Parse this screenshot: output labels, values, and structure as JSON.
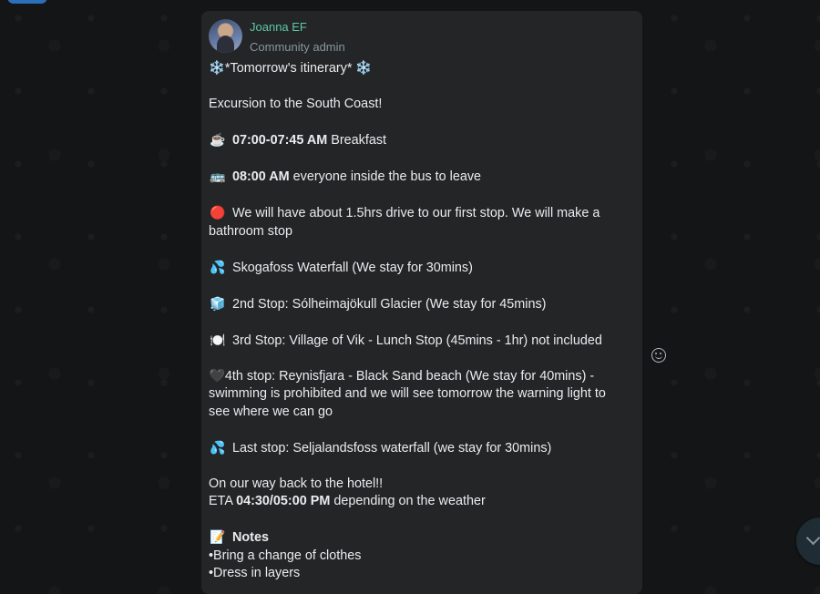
{
  "message": {
    "sender": "Joanna EF",
    "role": "Community admin",
    "title": "*Tomorrow's itinerary*",
    "intro": "Excursion to the South Coast!",
    "breakfast_time": "07:00-07:45 AM",
    "breakfast_text": "Breakfast",
    "bus_time": "08:00 AM",
    "bus_text": "everyone inside the bus to leave",
    "drive_text": "We will have about 1.5hrs drive to our first stop. We will make a",
    "drive_text_2": "bathroom stop",
    "stop1": "Skogafoss Waterfall (We stay for 30mins)",
    "stop2": "2nd Stop: Sólheimajökull Glacier (We stay for 45mins)",
    "stop3": "3rd Stop: Village of Vik - Lunch Stop (45mins - 1hr) not included",
    "stop4_line1": "4th stop: Reynisfjara - Black Sand beach (We stay for 40mins) -",
    "stop4_line2": "swimming is prohibited and we will see tomorrow the warning light to",
    "stop4_line3": "see where we can go",
    "last_stop": "Last stop: Seljalandsfoss waterfall (we stay for 30mins)",
    "return_text": "On our way back to the hotel!!",
    "eta_label": "ETA",
    "eta_time": "04:30/05:00 PM",
    "eta_text": "depending on the weather",
    "notes_title": "Notes",
    "note1": "•Bring a change of clothes",
    "note2": "•Dress in layers"
  },
  "icons": {
    "snowflake": "❄️",
    "coffee": "☕",
    "bus": "🚌",
    "red_circle": "🔴",
    "droplets": "💦",
    "ice": "🧊",
    "plate": "🍽️",
    "black_heart": "🖤",
    "memo": "📝"
  },
  "colors": {
    "background": "#131516",
    "bubble": "#232526",
    "sender": "#5fc8a8",
    "text": "#e9edef",
    "secondary": "#8696a0"
  }
}
